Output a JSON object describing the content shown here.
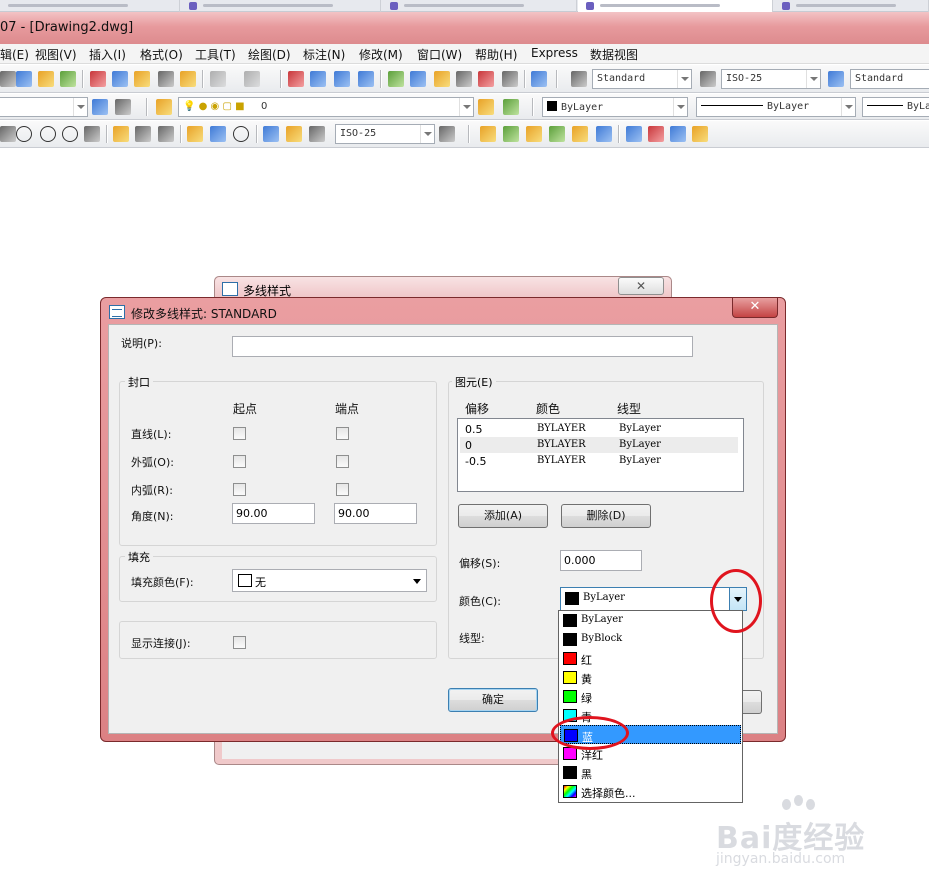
{
  "window": {
    "title": "07 - [Drawing2.dwg]"
  },
  "menu": {
    "items": [
      "辑(E)",
      "视图(V)",
      "插入(I)",
      "格式(O)",
      "工具(T)",
      "绘图(D)",
      "标注(N)",
      "修改(M)",
      "窗口(W)",
      "帮助(H)",
      "Express",
      "数据视图"
    ]
  },
  "toolbar": {
    "text_style_1": "Standard",
    "dim_style_1": "ISO-25",
    "table_style": "Standard",
    "layer_name": "0",
    "color_combo": "ByLayer",
    "linetype_combo": "ByLayer",
    "lineweight_combo": "ByLa",
    "dim_style_2": "ISO-25"
  },
  "bg_dialog": {
    "title": "多线样式",
    "close_glyph": "✕"
  },
  "dialog": {
    "title": "修改多线样式: STANDARD",
    "close_glyph": "✕",
    "description_label": "说明(P):",
    "description_value": "",
    "caps": {
      "title": "封口",
      "start_header": "起点",
      "end_header": "端点",
      "line_label": "直线(L):",
      "outer_arc_label": "外弧(O):",
      "inner_arc_label": "内弧(R):",
      "angle_label": "角度(N):",
      "start_angle": "90.00",
      "end_angle": "90.00"
    },
    "fill": {
      "title": "填充",
      "color_label": "填充颜色(F):",
      "color_value": "无"
    },
    "display_joints_label": "显示连接(J):",
    "elements": {
      "title": "图元(E)",
      "headers": [
        "偏移",
        "颜色",
        "线型"
      ],
      "rows": [
        {
          "offset": "0.5",
          "color": "BYLAYER",
          "linetype": "ByLayer"
        },
        {
          "offset": "0",
          "color": "BYLAYER",
          "linetype": "ByLayer"
        },
        {
          "offset": "-0.5",
          "color": "BYLAYER",
          "linetype": "ByLayer"
        }
      ],
      "add_button": "添加(A)",
      "delete_button": "删除(D)",
      "offset_label": "偏移(S):",
      "offset_value": "0.000",
      "color_label": "颜色(C):",
      "color_value": "ByLayer",
      "linetype_label": "线型:"
    },
    "ok_button": "确定"
  },
  "color_dropdown": {
    "options": [
      {
        "label": "ByLayer",
        "color": "#000000"
      },
      {
        "label": "ByBlock",
        "color": "#000000"
      },
      {
        "label": "红",
        "color": "#ff0000"
      },
      {
        "label": "黄",
        "color": "#ffff00"
      },
      {
        "label": "绿",
        "color": "#00ff00"
      },
      {
        "label": "青",
        "color": "#00ffff"
      },
      {
        "label": "蓝",
        "color": "#0000ff"
      },
      {
        "label": "洋红",
        "color": "#ff00ff"
      },
      {
        "label": "黑",
        "color": "#000000"
      },
      {
        "label": "选择颜色...",
        "color": "rainbow"
      }
    ],
    "selected_index": 6
  },
  "watermark": {
    "brand": "Bai度经验",
    "url": "jingyan.baidu.com"
  },
  "colors": {
    "accent_highlight": "#e0141e",
    "selection": "#3399ff",
    "dialog_frame": "#dc8184"
  }
}
